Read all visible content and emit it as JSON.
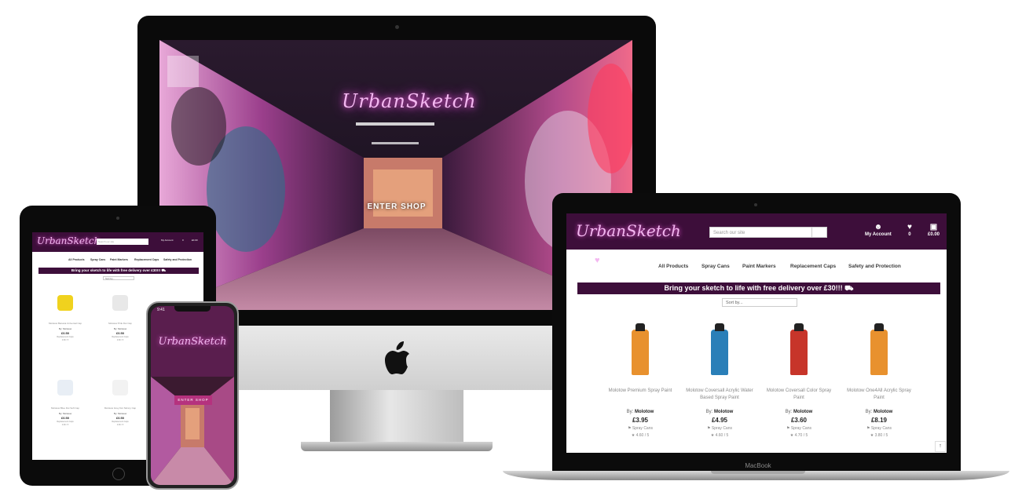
{
  "imac": {
    "logo": "UrbanSketch",
    "enter_shop": "ENTER SHOP"
  },
  "macbook": {
    "device_label": "MacBook",
    "logo": "UrbanSketch",
    "search_placeholder": "Search our site",
    "header_links": [
      {
        "label": "My Account",
        "icon": "user-icon"
      },
      {
        "label": "0",
        "icon": "heart-icon"
      },
      {
        "label": "£0.00",
        "icon": "shopping-bag-icon"
      }
    ],
    "nav": [
      "All Products",
      "Spray Cans",
      "Paint Markers",
      "Replacement Caps",
      "Safety and Protection"
    ],
    "banner": "Bring your sketch to life with free delivery over £30!!! ⛟",
    "sort_label": "Sort by...",
    "products": [
      {
        "name": "Molotow Premium Spray Paint",
        "brand_label": "By:",
        "brand": "Molotow",
        "price": "£3.95",
        "category": "Spray Cans",
        "rating": "4.60 / 5",
        "color": "#e8912e"
      },
      {
        "name": "Molotow Coversall Acrylic Water Based Spray Paint",
        "brand_label": "By:",
        "brand": "Molotow",
        "price": "£4.95",
        "category": "Spray Cans",
        "rating": "4.60 / 5",
        "color": "#2a7fb8"
      },
      {
        "name": "Molotow Coversall Color Spray Paint",
        "brand_label": "By:",
        "brand": "Molotow",
        "price": "£3.60",
        "category": "Spray Cans",
        "rating": "4.70 / 5",
        "color": "#c7352a"
      },
      {
        "name": "Molotow One4All Acrylic Spray Paint",
        "brand_label": "By:",
        "brand": "Molotow",
        "price": "£8.19",
        "category": "Spray Cans",
        "rating": "3.80 / 5",
        "color": "#e8912e"
      }
    ],
    "scroll_top": "↑"
  },
  "ipad": {
    "logo": "UrbanSketch",
    "search_placeholder": "Search our site",
    "header_links": [
      "My Account",
      "0",
      "£0.00"
    ],
    "nav": [
      "All Products",
      "Spray Cans",
      "Paint Markers",
      "Replacement Caps",
      "Safety and Protection"
    ],
    "banner": "Bring your sketch to life with free delivery over £30!!! ⛟",
    "sort_label": "Sort by...",
    "products": [
      {
        "name": "Molotow Banana Universal Cap",
        "brand": "By: Molotow",
        "price": "£0.50",
        "category": "Replacement Caps",
        "rating": "4.60 / 5",
        "color": "#f0d21e"
      },
      {
        "name": "Molotow Pink Dot Cap",
        "brand": "By: Molotow",
        "price": "£0.50",
        "category": "Replacement Caps",
        "rating": "4.60 / 5",
        "color": "#e8e8e8"
      },
      {
        "name": "Molotow Blue Dot Soft Cap",
        "brand": "By: Molotow",
        "price": "£0.50",
        "category": "Replacement Caps",
        "rating": "4.60 / 5",
        "color": "#e8eef5"
      },
      {
        "name": "Molotow Grey Dot Skinny Cap",
        "brand": "By: Molotow",
        "price": "£0.50",
        "category": "Replacement Caps",
        "rating": "4.60 / 5",
        "color": "#f2f2f2"
      }
    ]
  },
  "iphone": {
    "time": "9:41",
    "logo": "UrbanSketch",
    "enter_shop": "ENTER SHOP"
  },
  "colors": {
    "brand_purple": "#3d0e3a",
    "neon_pink": "#f3b7f0",
    "enter_button": "#b5327e"
  }
}
